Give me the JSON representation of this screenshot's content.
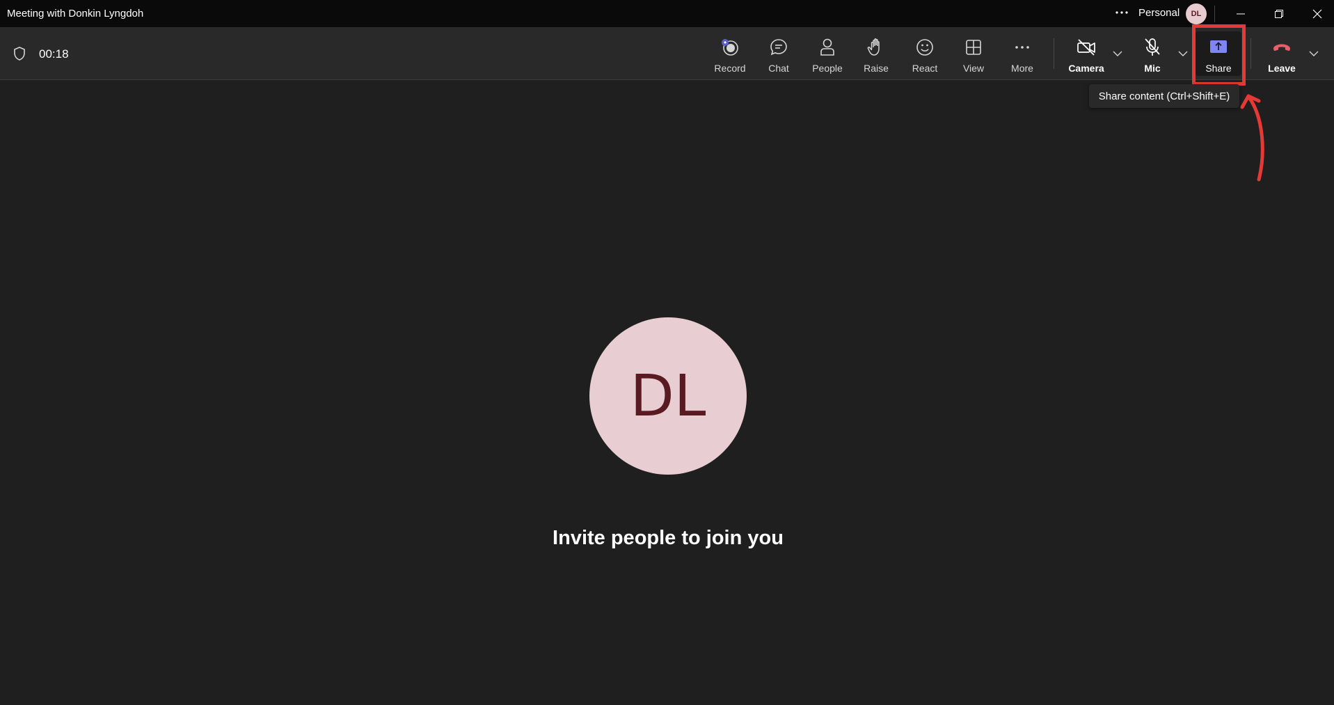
{
  "window": {
    "title": "Meeting with Donkin Lyngdoh",
    "more_icon": "more-horizontal-icon",
    "account_label": "Personal",
    "account_initials": "DL",
    "controls": [
      "minimize-icon",
      "restore-icon",
      "close-icon"
    ]
  },
  "toolbar": {
    "timer": "00:18",
    "items": {
      "record": "Record",
      "chat": "Chat",
      "people": "People",
      "raise": "Raise",
      "react": "React",
      "view": "View",
      "more": "More",
      "camera": "Camera",
      "mic": "Mic",
      "share": "Share",
      "leave": "Leave"
    },
    "share_tooltip": "Share content (Ctrl+Shift+E)"
  },
  "stage": {
    "avatar_initials": "DL",
    "invite_text": "Invite people to join you"
  },
  "colors": {
    "background": "#1f1f1f",
    "toolbar": "#292929",
    "titlebar": "#0a0a0a",
    "accent": "#7f85f5",
    "leave_red": "#e5606a",
    "annotation_red": "#e53935",
    "avatar_bg": "#e8cdd2",
    "avatar_text": "#5a1a22"
  }
}
